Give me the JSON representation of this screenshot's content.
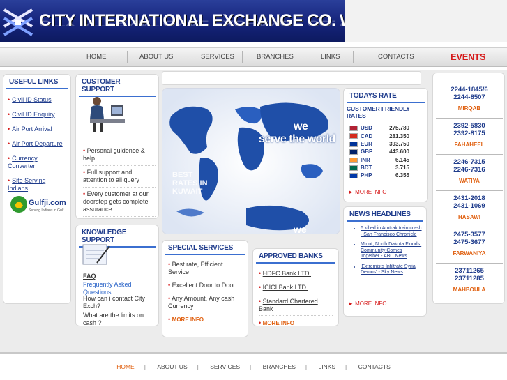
{
  "header": {
    "title": "CITY INTERNATIONAL EXCHANGE CO. W.L.L"
  },
  "nav": {
    "items": [
      "HOME",
      "ABOUT US",
      "SERVICES",
      "BRANCHES",
      "LINKS",
      "CONTACTS"
    ],
    "events": "EVENTS"
  },
  "useful_links": {
    "title": "USEFUL LINKS",
    "items": [
      "Civil ID Status",
      "Civil ID Enquiry",
      "Air Port Arrival",
      "Air Port Departure",
      "Currency Converter",
      "Site Serving Indians"
    ],
    "gulfji": {
      "name": "Gulfji.com",
      "tagline": "Serving Indians in Gulf"
    }
  },
  "customer_support": {
    "title": "CUSTOMER SUPPORT",
    "items": [
      "Personal guidence & help",
      "Full support and attention to all query",
      "Every customer at our doorstep gets complete assurance"
    ]
  },
  "knowledge_support": {
    "title": "KNOWLEDGE SUPPORT",
    "faq": "FAQ",
    "faq_sub": "Frequently Asked Questions",
    "questions": [
      "How can i contact City Exch?",
      "What are the limits on cash ?"
    ]
  },
  "banner": {
    "headline_1": "we",
    "headline_2": "serve the world",
    "best_1": "BEST",
    "best_2": "RATES IN",
    "best_3": "KUWAIT",
    "we_bottom": "we"
  },
  "special_services": {
    "title": "SPECIAL SERVICES",
    "items": [
      "Best rate, Efficient Service",
      "Excellent Door to Door",
      "Any Amount, Any cash  Currency"
    ],
    "more": "MORE INFO"
  },
  "approved_banks": {
    "title": "APPROVED BANKS",
    "items": [
      "HDFC Bank LTD.",
      "ICICI Bank LTD.",
      "Standard Chartered Bank"
    ],
    "more": "MORE INFO"
  },
  "rates": {
    "title": "TODAYS RATE",
    "subtitle": "CUSTOMER FRIENDLY RATES",
    "rows": [
      {
        "code": "USD",
        "value": "275.780",
        "flag": "us-flag",
        "color": "#b22234"
      },
      {
        "code": "CAD",
        "value": "281.350",
        "flag": "ca-flag",
        "color": "#d52b1e"
      },
      {
        "code": "EUR",
        "value": "393.750",
        "flag": "eu-flag",
        "color": "#003399"
      },
      {
        "code": "GBP",
        "value": "443.600",
        "flag": "gb-flag",
        "color": "#012169"
      },
      {
        "code": "INR",
        "value": "6.145",
        "flag": "in-flag",
        "color": "#ff9933"
      },
      {
        "code": "BDT",
        "value": "3.715",
        "flag": "bd-flag",
        "color": "#006a4e"
      },
      {
        "code": "PHP",
        "value": "6.355",
        "flag": "ph-flag",
        "color": "#0038a8"
      }
    ],
    "more": "MORE INFO"
  },
  "news": {
    "title": "NEWS HEADLINES",
    "items": [
      "6 killed in Amtrak train crash - San Francisco Chronicle",
      "Minot, North Dakota Floods: Community Comes Together - ABC News",
      "'Extremists Infiltrate Syria Demos' - Sky News"
    ],
    "more": "MORE INFO"
  },
  "branches": [
    {
      "phone1": "2244-1845/6",
      "phone2": "2244-8507",
      "name": "MIRQAB"
    },
    {
      "phone1": "2392-5830",
      "phone2": "2392-8175",
      "name": "FAHAHEEL"
    },
    {
      "phone1": "2246-7315",
      "phone2": "2246-7316",
      "name": "WATIYA"
    },
    {
      "phone1": "2431-2018",
      "phone2": "2431-1069",
      "name": "HASAWI"
    },
    {
      "phone1": "2475-3577",
      "phone2": "2475-3677",
      "name": "FARWANIYA"
    },
    {
      "phone1": "23711265",
      "phone2": "23711285",
      "name": "MAHBOULA"
    }
  ],
  "footer": {
    "items": [
      "HOME",
      "ABOUT US",
      "SERVICES",
      "BRANCHES",
      "LINKS",
      "CONTACTS"
    ]
  }
}
